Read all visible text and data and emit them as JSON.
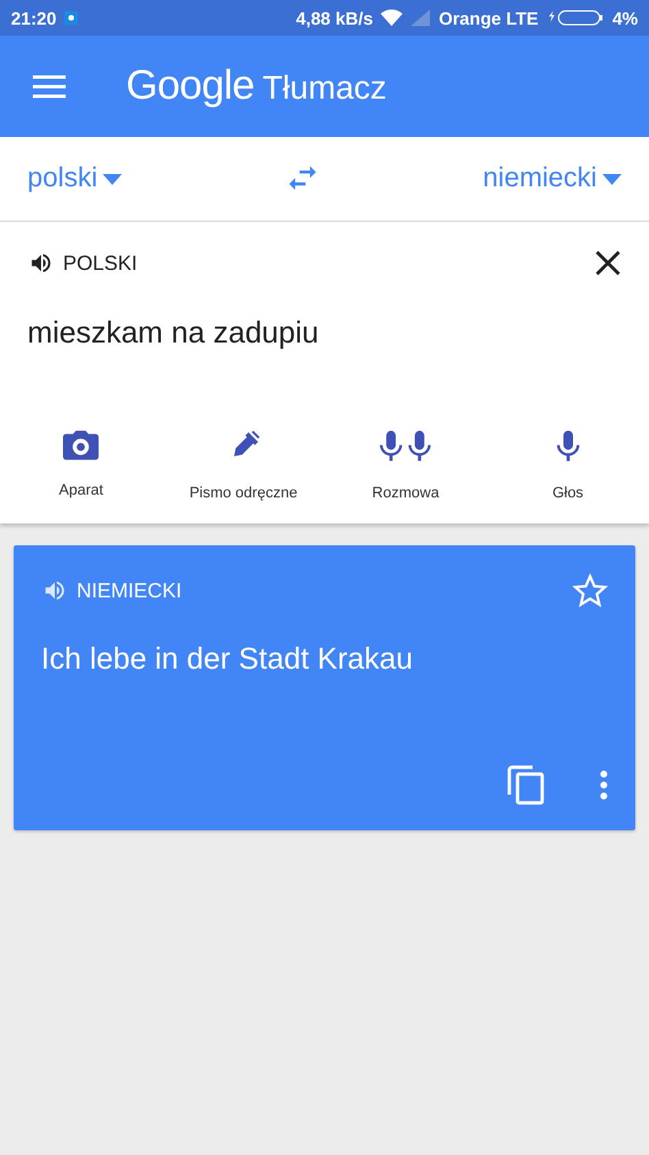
{
  "status_bar": {
    "time": "21:20",
    "speed": "4,88 kB/s",
    "carrier": "Orange LTE",
    "battery": "4%"
  },
  "app_bar": {
    "logo": "Google",
    "title": "Tłumacz"
  },
  "languages": {
    "source": "polski",
    "target": "niemiecki"
  },
  "input": {
    "language": "POLSKI",
    "text": "mieszkam na zadupiu"
  },
  "tools": [
    {
      "kind": "camera",
      "label": "Aparat"
    },
    {
      "kind": "pen",
      "label": "Pismo odręczne"
    },
    {
      "kind": "conversation",
      "label": "Rozmowa"
    },
    {
      "kind": "voice",
      "label": "Głos"
    }
  ],
  "result": {
    "language": "NIEMIECKI",
    "text": "Ich lebe in der Stadt Krakau",
    "starred": false
  }
}
